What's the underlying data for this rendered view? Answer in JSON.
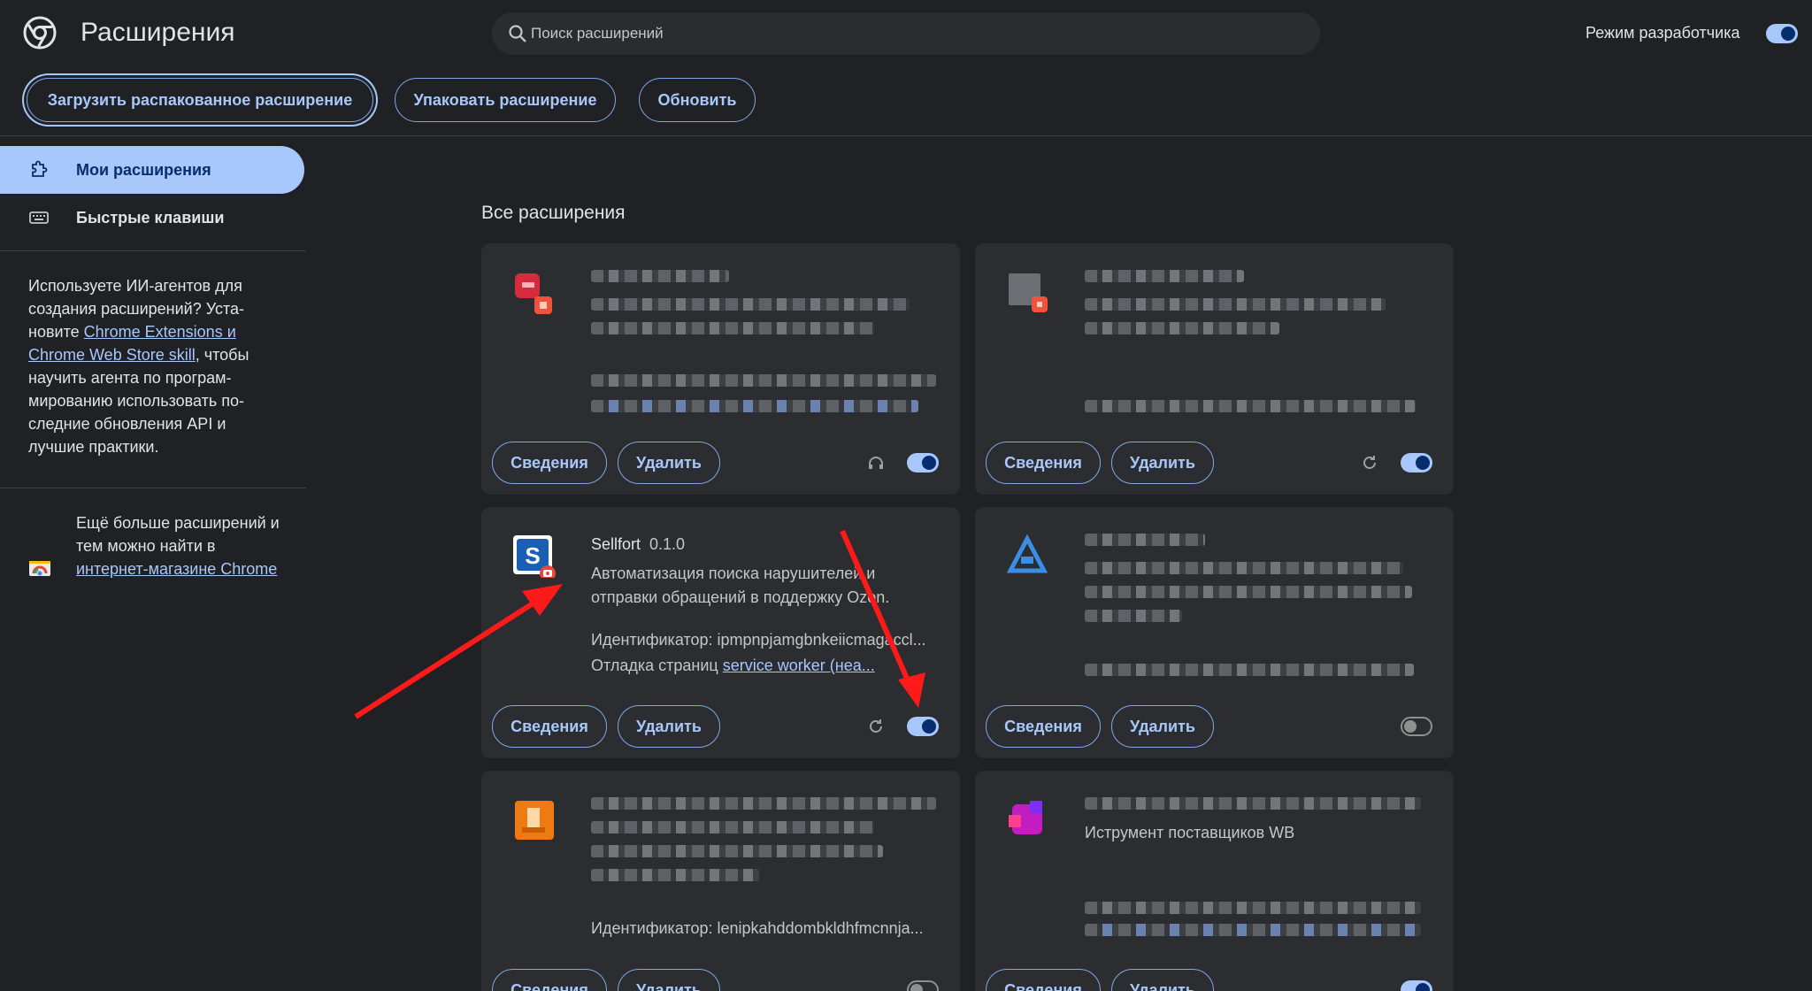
{
  "header": {
    "title": "Расширения",
    "search_placeholder": "Поиск расширений",
    "devmode_label": "Режим разработчика",
    "devmode_on": true
  },
  "toolbar": {
    "load_unpacked": "Загрузить распакованное расширение",
    "pack": "Упаковать расширение",
    "update": "Обновить"
  },
  "sidebar": {
    "items": [
      {
        "label": "Мои расширения",
        "icon": "puzzle-icon",
        "active": true
      },
      {
        "label": "Быстрые клавиши",
        "icon": "keyboard-icon",
        "active": false
      }
    ],
    "info": {
      "before": "Используете ИИ-агентов для создания расширений? Уста-новите ",
      "link": "Chrome Extensions и Chrome Web Store skill",
      "after": ", чтобы научить агента по програм-мированию использовать по-следние обновления API и лучшие практики."
    },
    "store": {
      "before": "Ещё больше расширений и тем можно найти в ",
      "link": "интернет-магазине Chrome"
    }
  },
  "main": {
    "section_title": "Все расширения",
    "details_label": "Сведения",
    "remove_label": "Удалить",
    "cards": [
      {
        "name": "",
        "version": "",
        "toggle": "on"
      },
      {
        "name": "",
        "version": "",
        "toggle": "on"
      },
      {
        "name": "Sellfort",
        "version": "0.1.0",
        "description": "Автоматизация поиска нарушителей и отправки обращений в поддержку Ozon.",
        "id_text": "Идентификатор: ipmpnpjamgbnkeiicmagaccl...",
        "sw_prefix": "Отладка страниц ",
        "sw_link": "service worker (неа...",
        "toggle": "on"
      },
      {
        "name": "",
        "version": "",
        "toggle": "off"
      },
      {
        "name": "",
        "version": "",
        "desc_fragment": "Иструмент поставщиков WB",
        "id_text": "Идентификатор: lenipkahddombkldhfmcnnja...",
        "toggle": "off"
      },
      {
        "name": "",
        "version": "",
        "toggle": "on"
      }
    ],
    "card5_id": "Идентификатор: lenipkahddombkldhfmcnnja...",
    "card6_fragment": "Иструмент поставщиков WB"
  },
  "colors": {
    "background": "#1f2124",
    "card": "#2b2d31",
    "accent": "#a8c7fa",
    "arrow": "#ff1a1a"
  }
}
